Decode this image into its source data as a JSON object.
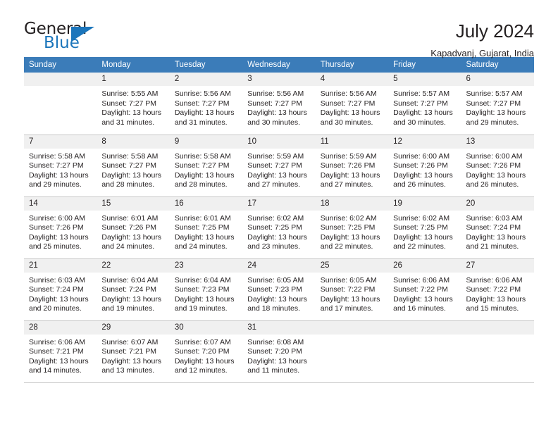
{
  "logo": {
    "word_one": "General",
    "word_two": "Blue",
    "triangle": "blue-triangle",
    "primary_color": "#1b75bb"
  },
  "header": {
    "title": "July 2024",
    "subtitle": "Kapadvanj, Gujarat, India"
  },
  "theme": {
    "header_row_bg": "#3b7cb9",
    "daynum_bg": "#f0f0f0",
    "grid_line": "#c8c8c8",
    "text": "#231f20"
  },
  "weekday_headers": [
    "Sunday",
    "Monday",
    "Tuesday",
    "Wednesday",
    "Thursday",
    "Friday",
    "Saturday"
  ],
  "weeks": [
    [
      {
        "day": "",
        "empty": true,
        "sunrise": "",
        "sunset": "",
        "daylight_line1": "",
        "daylight_line2": ""
      },
      {
        "day": "1",
        "empty": false,
        "sunrise": "Sunrise: 5:55 AM",
        "sunset": "Sunset: 7:27 PM",
        "daylight_line1": "Daylight: 13 hours",
        "daylight_line2": "and 31 minutes."
      },
      {
        "day": "2",
        "empty": false,
        "sunrise": "Sunrise: 5:56 AM",
        "sunset": "Sunset: 7:27 PM",
        "daylight_line1": "Daylight: 13 hours",
        "daylight_line2": "and 31 minutes."
      },
      {
        "day": "3",
        "empty": false,
        "sunrise": "Sunrise: 5:56 AM",
        "sunset": "Sunset: 7:27 PM",
        "daylight_line1": "Daylight: 13 hours",
        "daylight_line2": "and 30 minutes."
      },
      {
        "day": "4",
        "empty": false,
        "sunrise": "Sunrise: 5:56 AM",
        "sunset": "Sunset: 7:27 PM",
        "daylight_line1": "Daylight: 13 hours",
        "daylight_line2": "and 30 minutes."
      },
      {
        "day": "5",
        "empty": false,
        "sunrise": "Sunrise: 5:57 AM",
        "sunset": "Sunset: 7:27 PM",
        "daylight_line1": "Daylight: 13 hours",
        "daylight_line2": "and 30 minutes."
      },
      {
        "day": "6",
        "empty": false,
        "sunrise": "Sunrise: 5:57 AM",
        "sunset": "Sunset: 7:27 PM",
        "daylight_line1": "Daylight: 13 hours",
        "daylight_line2": "and 29 minutes."
      }
    ],
    [
      {
        "day": "7",
        "empty": false,
        "sunrise": "Sunrise: 5:58 AM",
        "sunset": "Sunset: 7:27 PM",
        "daylight_line1": "Daylight: 13 hours",
        "daylight_line2": "and 29 minutes."
      },
      {
        "day": "8",
        "empty": false,
        "sunrise": "Sunrise: 5:58 AM",
        "sunset": "Sunset: 7:27 PM",
        "daylight_line1": "Daylight: 13 hours",
        "daylight_line2": "and 28 minutes."
      },
      {
        "day": "9",
        "empty": false,
        "sunrise": "Sunrise: 5:58 AM",
        "sunset": "Sunset: 7:27 PM",
        "daylight_line1": "Daylight: 13 hours",
        "daylight_line2": "and 28 minutes."
      },
      {
        "day": "10",
        "empty": false,
        "sunrise": "Sunrise: 5:59 AM",
        "sunset": "Sunset: 7:27 PM",
        "daylight_line1": "Daylight: 13 hours",
        "daylight_line2": "and 27 minutes."
      },
      {
        "day": "11",
        "empty": false,
        "sunrise": "Sunrise: 5:59 AM",
        "sunset": "Sunset: 7:26 PM",
        "daylight_line1": "Daylight: 13 hours",
        "daylight_line2": "and 27 minutes."
      },
      {
        "day": "12",
        "empty": false,
        "sunrise": "Sunrise: 6:00 AM",
        "sunset": "Sunset: 7:26 PM",
        "daylight_line1": "Daylight: 13 hours",
        "daylight_line2": "and 26 minutes."
      },
      {
        "day": "13",
        "empty": false,
        "sunrise": "Sunrise: 6:00 AM",
        "sunset": "Sunset: 7:26 PM",
        "daylight_line1": "Daylight: 13 hours",
        "daylight_line2": "and 26 minutes."
      }
    ],
    [
      {
        "day": "14",
        "empty": false,
        "sunrise": "Sunrise: 6:00 AM",
        "sunset": "Sunset: 7:26 PM",
        "daylight_line1": "Daylight: 13 hours",
        "daylight_line2": "and 25 minutes."
      },
      {
        "day": "15",
        "empty": false,
        "sunrise": "Sunrise: 6:01 AM",
        "sunset": "Sunset: 7:26 PM",
        "daylight_line1": "Daylight: 13 hours",
        "daylight_line2": "and 24 minutes."
      },
      {
        "day": "16",
        "empty": false,
        "sunrise": "Sunrise: 6:01 AM",
        "sunset": "Sunset: 7:25 PM",
        "daylight_line1": "Daylight: 13 hours",
        "daylight_line2": "and 24 minutes."
      },
      {
        "day": "17",
        "empty": false,
        "sunrise": "Sunrise: 6:02 AM",
        "sunset": "Sunset: 7:25 PM",
        "daylight_line1": "Daylight: 13 hours",
        "daylight_line2": "and 23 minutes."
      },
      {
        "day": "18",
        "empty": false,
        "sunrise": "Sunrise: 6:02 AM",
        "sunset": "Sunset: 7:25 PM",
        "daylight_line1": "Daylight: 13 hours",
        "daylight_line2": "and 22 minutes."
      },
      {
        "day": "19",
        "empty": false,
        "sunrise": "Sunrise: 6:02 AM",
        "sunset": "Sunset: 7:25 PM",
        "daylight_line1": "Daylight: 13 hours",
        "daylight_line2": "and 22 minutes."
      },
      {
        "day": "20",
        "empty": false,
        "sunrise": "Sunrise: 6:03 AM",
        "sunset": "Sunset: 7:24 PM",
        "daylight_line1": "Daylight: 13 hours",
        "daylight_line2": "and 21 minutes."
      }
    ],
    [
      {
        "day": "21",
        "empty": false,
        "sunrise": "Sunrise: 6:03 AM",
        "sunset": "Sunset: 7:24 PM",
        "daylight_line1": "Daylight: 13 hours",
        "daylight_line2": "and 20 minutes."
      },
      {
        "day": "22",
        "empty": false,
        "sunrise": "Sunrise: 6:04 AM",
        "sunset": "Sunset: 7:24 PM",
        "daylight_line1": "Daylight: 13 hours",
        "daylight_line2": "and 19 minutes."
      },
      {
        "day": "23",
        "empty": false,
        "sunrise": "Sunrise: 6:04 AM",
        "sunset": "Sunset: 7:23 PM",
        "daylight_line1": "Daylight: 13 hours",
        "daylight_line2": "and 19 minutes."
      },
      {
        "day": "24",
        "empty": false,
        "sunrise": "Sunrise: 6:05 AM",
        "sunset": "Sunset: 7:23 PM",
        "daylight_line1": "Daylight: 13 hours",
        "daylight_line2": "and 18 minutes."
      },
      {
        "day": "25",
        "empty": false,
        "sunrise": "Sunrise: 6:05 AM",
        "sunset": "Sunset: 7:22 PM",
        "daylight_line1": "Daylight: 13 hours",
        "daylight_line2": "and 17 minutes."
      },
      {
        "day": "26",
        "empty": false,
        "sunrise": "Sunrise: 6:06 AM",
        "sunset": "Sunset: 7:22 PM",
        "daylight_line1": "Daylight: 13 hours",
        "daylight_line2": "and 16 minutes."
      },
      {
        "day": "27",
        "empty": false,
        "sunrise": "Sunrise: 6:06 AM",
        "sunset": "Sunset: 7:22 PM",
        "daylight_line1": "Daylight: 13 hours",
        "daylight_line2": "and 15 minutes."
      }
    ],
    [
      {
        "day": "28",
        "empty": false,
        "sunrise": "Sunrise: 6:06 AM",
        "sunset": "Sunset: 7:21 PM",
        "daylight_line1": "Daylight: 13 hours",
        "daylight_line2": "and 14 minutes."
      },
      {
        "day": "29",
        "empty": false,
        "sunrise": "Sunrise: 6:07 AM",
        "sunset": "Sunset: 7:21 PM",
        "daylight_line1": "Daylight: 13 hours",
        "daylight_line2": "and 13 minutes."
      },
      {
        "day": "30",
        "empty": false,
        "sunrise": "Sunrise: 6:07 AM",
        "sunset": "Sunset: 7:20 PM",
        "daylight_line1": "Daylight: 13 hours",
        "daylight_line2": "and 12 minutes."
      },
      {
        "day": "31",
        "empty": false,
        "sunrise": "Sunrise: 6:08 AM",
        "sunset": "Sunset: 7:20 PM",
        "daylight_line1": "Daylight: 13 hours",
        "daylight_line2": "and 11 minutes."
      },
      {
        "day": "",
        "empty": true,
        "sunrise": "",
        "sunset": "",
        "daylight_line1": "",
        "daylight_line2": ""
      },
      {
        "day": "",
        "empty": true,
        "sunrise": "",
        "sunset": "",
        "daylight_line1": "",
        "daylight_line2": ""
      },
      {
        "day": "",
        "empty": true,
        "sunrise": "",
        "sunset": "",
        "daylight_line1": "",
        "daylight_line2": ""
      }
    ]
  ]
}
